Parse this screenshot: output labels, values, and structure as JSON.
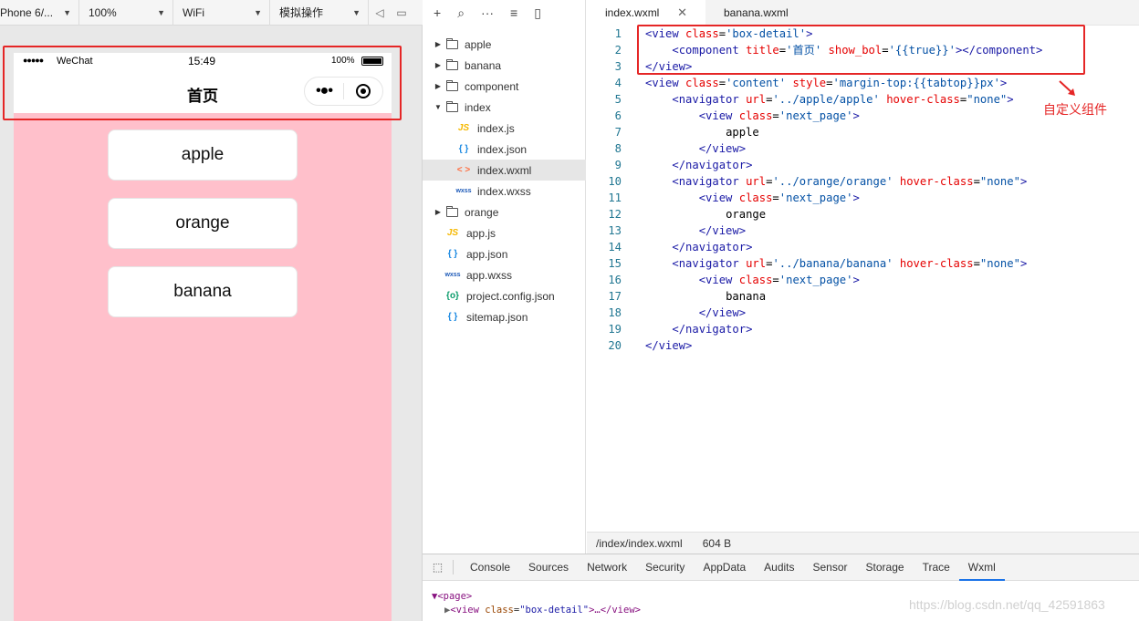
{
  "simulator": {
    "toolbar": {
      "device": "Phone 6/...",
      "zoom": "100%",
      "network": "WiFi",
      "operation": "模拟操作"
    },
    "status_bar": {
      "signal": "●●●●●",
      "carrier": "WeChat",
      "time": "15:49",
      "battery": "100%"
    },
    "nav_title": "首页",
    "capsule_menu": "•●•",
    "buttons": [
      "apple",
      "orange",
      "banana"
    ],
    "background_color": "#ffc0cb"
  },
  "file_tree": {
    "items": [
      {
        "name": "apple",
        "type": "folder",
        "expanded": false
      },
      {
        "name": "banana",
        "type": "folder",
        "expanded": false
      },
      {
        "name": "component",
        "type": "folder",
        "expanded": false
      },
      {
        "name": "index",
        "type": "folder",
        "expanded": true
      },
      {
        "name": "index.js",
        "type": "js",
        "icon": "JS"
      },
      {
        "name": "index.json",
        "type": "json",
        "icon": "{ }"
      },
      {
        "name": "index.wxml",
        "type": "wxml",
        "icon": "< >",
        "active": true
      },
      {
        "name": "index.wxss",
        "type": "wxss",
        "icon": "wxss"
      },
      {
        "name": "orange",
        "type": "folder",
        "expanded": false
      },
      {
        "name": "app.js",
        "type": "js",
        "icon": "JS"
      },
      {
        "name": "app.json",
        "type": "json",
        "icon": "{ }"
      },
      {
        "name": "app.wxss",
        "type": "wxss",
        "icon": "wxss"
      },
      {
        "name": "project.config.json",
        "type": "cfg",
        "icon": "{o}"
      },
      {
        "name": "sitemap.json",
        "type": "json",
        "icon": "{ }"
      }
    ]
  },
  "editor": {
    "tabs": [
      {
        "label": "index.wxml",
        "active": true
      },
      {
        "label": "banana.wxml",
        "active": false
      }
    ],
    "lines": [
      "<view class='box-detail'>",
      "    <component title='首页' show_bol='{{true}}'></component>",
      "</view>",
      "<view class='content' style='margin-top:{{tabtop}}px'>",
      "    <navigator url='../apple/apple' hover-class=\"none\">",
      "        <view class='next_page'>",
      "            apple",
      "        </view>",
      "    </navigator>",
      "    <navigator url='../orange/orange' hover-class=\"none\">",
      "        <view class='next_page'>",
      "            orange",
      "        </view>",
      "    </navigator>",
      "    <navigator url='../banana/banana' hover-class=\"none\">",
      "        <view class='next_page'>",
      "            banana",
      "        </view>",
      "    </navigator>",
      "</view>"
    ],
    "annotation": "自定义组件",
    "status": {
      "path": "/index/index.wxml",
      "size": "604 B"
    }
  },
  "devtools": {
    "tabs": [
      "Console",
      "Sources",
      "Network",
      "Security",
      "AppData",
      "Audits",
      "Sensor",
      "Storage",
      "Trace",
      "Wxml"
    ],
    "active_tab": "Wxml",
    "tree_line1": "▼<page>",
    "tree_line2_tag": "<view",
    "tree_line2_attr": "class",
    "tree_line2_val": "\"box-detail\"",
    "tree_line2_rest": ">…</view>"
  },
  "watermark": "https://blog.csdn.net/qq_42591863",
  "colors": {
    "highlight_box": "#e52626",
    "phone_bg": "#ffc0cb",
    "active_tab_underline": "#1a73e8"
  }
}
